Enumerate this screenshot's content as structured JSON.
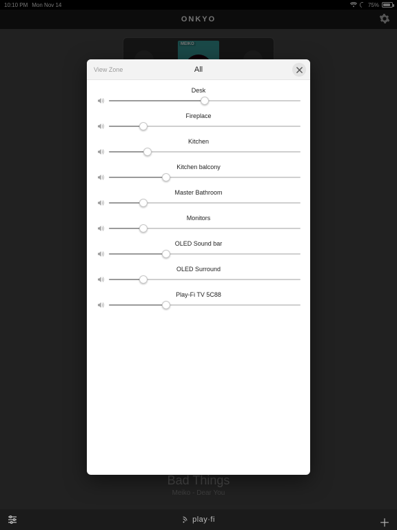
{
  "status": {
    "time": "10:10 PM",
    "date": "Mon Nov 14",
    "battery": "75%"
  },
  "app": {
    "brand": "ONKYO"
  },
  "modal": {
    "view_zone_label": "View Zone",
    "title": "All",
    "zones": [
      {
        "name": "Desk",
        "level": 50
      },
      {
        "name": "Fireplace",
        "level": 18
      },
      {
        "name": "Kitchen",
        "level": 20
      },
      {
        "name": "Kitchen balcony",
        "level": 30
      },
      {
        "name": "Master Bathroom",
        "level": 18
      },
      {
        "name": "Monitors",
        "level": 18
      },
      {
        "name": "OLED Sound bar",
        "level": 30
      },
      {
        "name": "OLED Surround",
        "level": 18
      },
      {
        "name": "Play-Fi TV 5C88",
        "level": 30
      }
    ]
  },
  "now_playing": {
    "title": "Bad Things",
    "subtitle": "Meiko - Dear You"
  },
  "footer": {
    "logo_text": "play·fi"
  }
}
